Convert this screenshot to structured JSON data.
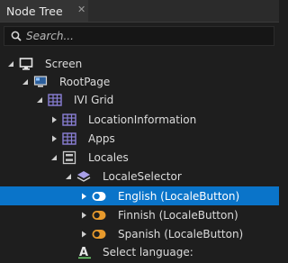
{
  "tab": {
    "title": "Node Tree",
    "close_glyph": "✕"
  },
  "search": {
    "placeholder": "Search..."
  },
  "tree": [
    {
      "label": "Screen",
      "icon": "screen-icon",
      "expanded": true,
      "selected": false
    },
    {
      "label": "RootPage",
      "icon": "page-icon",
      "expanded": true,
      "selected": false
    },
    {
      "label": "IVI Grid",
      "icon": "grid-icon",
      "expanded": true,
      "selected": false
    },
    {
      "label": "LocationInformation",
      "icon": "grid-icon",
      "expanded": false,
      "selected": false
    },
    {
      "label": "Apps",
      "icon": "grid-icon",
      "expanded": false,
      "selected": false
    },
    {
      "label": "Locales",
      "icon": "stack-layout-icon",
      "expanded": true,
      "selected": false
    },
    {
      "label": "LocaleSelector",
      "icon": "layers-icon",
      "expanded": true,
      "selected": false
    },
    {
      "label": "English (LocaleButton)",
      "icon": "toggle-button-icon",
      "expanded": false,
      "selected": true
    },
    {
      "label": "Finnish (LocaleButton)",
      "icon": "toggle-button-icon",
      "expanded": false,
      "selected": false
    },
    {
      "label": "Spanish (LocaleButton)",
      "icon": "toggle-button-icon",
      "expanded": false,
      "selected": false
    },
    {
      "label": "Select language:",
      "icon": "text-block-icon",
      "expanded": false,
      "selected": false
    }
  ],
  "colors": {
    "selection": "#0a74c9",
    "toggle_orange": "#e89a2c",
    "grid_purple": "#8a7fd6",
    "screen_blue": "#5aa0e6",
    "text_green": "#6fcf6f"
  }
}
